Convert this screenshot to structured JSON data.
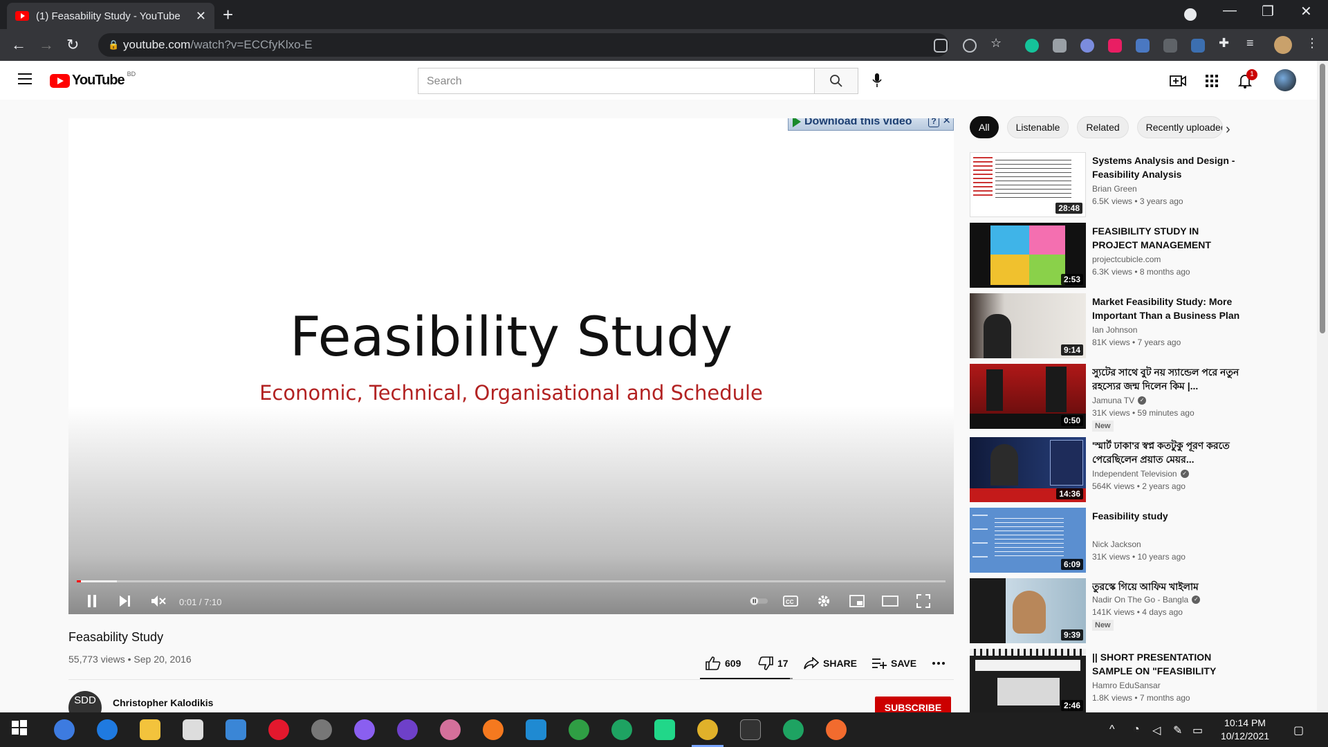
{
  "browser": {
    "tab_title": "(1) Feasability Study - YouTube",
    "tab_close": "✕",
    "new_tab": "+",
    "url_host": "youtube.com",
    "url_path": "/watch?v=ECCfyKlxo-E",
    "window_minimize": "—",
    "window_restore": "❐",
    "window_close": "✕"
  },
  "youtube": {
    "logo_text": "YouTube",
    "country": "BD",
    "search_placeholder": "Search",
    "notification_count": "1"
  },
  "player": {
    "slide_title": "Feasibility Study",
    "slide_subtitle": "Economic, Technical, Organisational and Schedule",
    "download_banner": "Download this video",
    "download_help": "?",
    "download_close": "✕",
    "time": "0:01 / 7:10",
    "progress_fraction": 0.002
  },
  "video": {
    "title": "Feasability Study",
    "meta": "55,773 views • Sep 20, 2016",
    "likes": "609",
    "dislikes": "17",
    "share": "SHARE",
    "save": "SAVE",
    "like_ratio": 0.97,
    "channel_initials": "SDD",
    "channel_name": "Christopher Kalodikis",
    "subscribe": "SUBSCRIBE"
  },
  "chips": [
    "All",
    "Listenable",
    "Related",
    "Recently uploaded"
  ],
  "recommendations": [
    {
      "title": "Systems Analysis and Design - Feasibility Analysis",
      "channel": "Brian Green",
      "meta": "6.5K views • 3 years ago",
      "duration": "28:48",
      "verified": false,
      "is_new": false
    },
    {
      "title": "FEASIBILITY STUDY IN PROJECT MANAGEMENT",
      "channel": "projectcubicle.com",
      "meta": "6.3K views • 8 months ago",
      "duration": "2:53",
      "verified": false,
      "is_new": false
    },
    {
      "title": "Market Feasibility Study: More Important Than a Business Plan",
      "channel": "Ian Johnson",
      "meta": "81K views • 7 years ago",
      "duration": "9:14",
      "verified": false,
      "is_new": false
    },
    {
      "title": "স্যুটের সাথে বুট নয় স্যান্ডেল পরে নতুন রহস্যের জন্ম দিলেন কিম |...",
      "channel": "Jamuna TV",
      "meta": "31K views • 59 minutes ago",
      "duration": "0:50",
      "verified": true,
      "is_new": true
    },
    {
      "title": "'স্মার্ট ঢাকা'র স্বপ্ন কতটুকু পূরণ করতে পেরেছিলেন প্রয়াত মেয়র...",
      "channel": "Independent Television",
      "meta": "564K views • 2 years ago",
      "duration": "14:36",
      "verified": true,
      "is_new": false
    },
    {
      "title": "Feasibility study",
      "channel": "Nick Jackson",
      "meta": "31K views • 10 years ago",
      "duration": "6:09",
      "verified": false,
      "is_new": false
    },
    {
      "title": "তুরস্কে গিয়ে আফিম খাইলাম",
      "channel": "Nadir On The Go - Bangla",
      "meta": "141K views • 4 days ago",
      "duration": "9:39",
      "verified": true,
      "is_new": true
    },
    {
      "title": "|| SHORT PRESENTATION SAMPLE ON \"FEASIBILITY STUDY\"",
      "channel": "Hamro EduSansar",
      "meta": "1.8K views • 7 months ago",
      "duration": "2:46",
      "verified": false,
      "is_new": false
    }
  ],
  "new_label": "New",
  "taskbar": {
    "time": "10:14 PM",
    "date": "10/12/2021"
  }
}
